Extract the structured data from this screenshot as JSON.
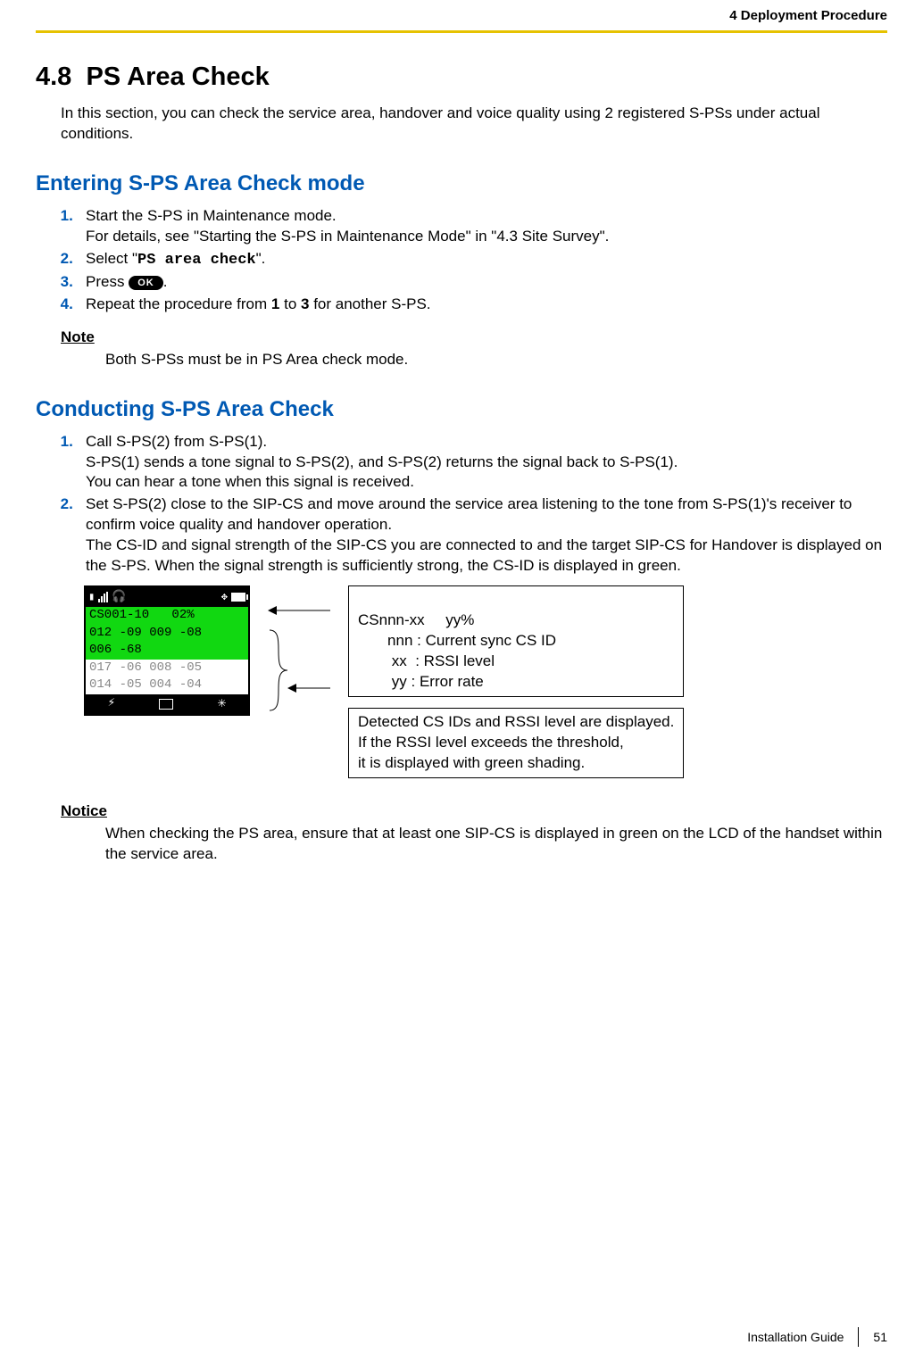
{
  "header": {
    "chapter": "4 Deployment Procedure"
  },
  "section": {
    "number": "4.8",
    "title": "PS Area Check"
  },
  "intro": "In this section, you can check the service area, handover and voice quality using 2 registered S-PSs under actual conditions.",
  "entering": {
    "heading": "Entering S-PS Area Check mode",
    "steps": {
      "s1": "Start the S-PS in Maintenance mode.",
      "s1b": "For details, see \"Starting the S-PS in Maintenance Mode\" in \"4.3  Site Survey\".",
      "s2a": "Select \"",
      "s2code": "PS area check",
      "s2b": "\".",
      "s3a": "Press ",
      "s3btn": "OK",
      "s3b": ".",
      "s4a": "Repeat the procedure from ",
      "s4b": " to ",
      "s4c": " for another S-PS.",
      "s4n1": "1",
      "s4n3": "3"
    },
    "note_label": "Note",
    "note_body": "Both S-PSs must be in PS Area check mode."
  },
  "conducting": {
    "heading": "Conducting S-PS Area Check",
    "s1a": "Call S-PS(2) from S-PS(1).",
    "s1b": "S-PS(1) sends a tone signal to S-PS(2), and S-PS(2) returns the signal back to S-PS(1).",
    "s1c": "You can hear a tone when this signal is received.",
    "s2a": "Set S-PS(2) close to the SIP-CS and move around the service area listening to the tone from S-PS(1)'s receiver to confirm voice quality and handover operation.",
    "s2b": "The CS-ID and signal strength of the SIP-CS you are connected to and the target SIP-CS for Handover is displayed on the S-PS. When the signal strength is sufficiently strong, the CS-ID is displayed in green."
  },
  "lcd": {
    "line1": "CS001-10   02%",
    "line2": "012 -09 009 -08",
    "line3": "006 -68",
    "line4": "017 -06 008 -05",
    "line5": "014 -05 004 -04"
  },
  "legend1": {
    "l1": "CSnnn-xx     yy%",
    "l2": "       nnn : Current sync CS ID",
    "l3": "        xx  : RSSI level",
    "l4": "        yy : Error rate"
  },
  "legend2": {
    "l1": "Detected  CS IDs and RSSI level are displayed.",
    "l2": "If the RSSI level exceeds the threshold,",
    "l3": "it is displayed with green shading."
  },
  "notice": {
    "label": "Notice",
    "body": "When checking the PS area, ensure that at least one SIP-CS is displayed in green on the LCD of the handset within the service area."
  },
  "footer": {
    "doc": "Installation Guide",
    "page": "51"
  }
}
